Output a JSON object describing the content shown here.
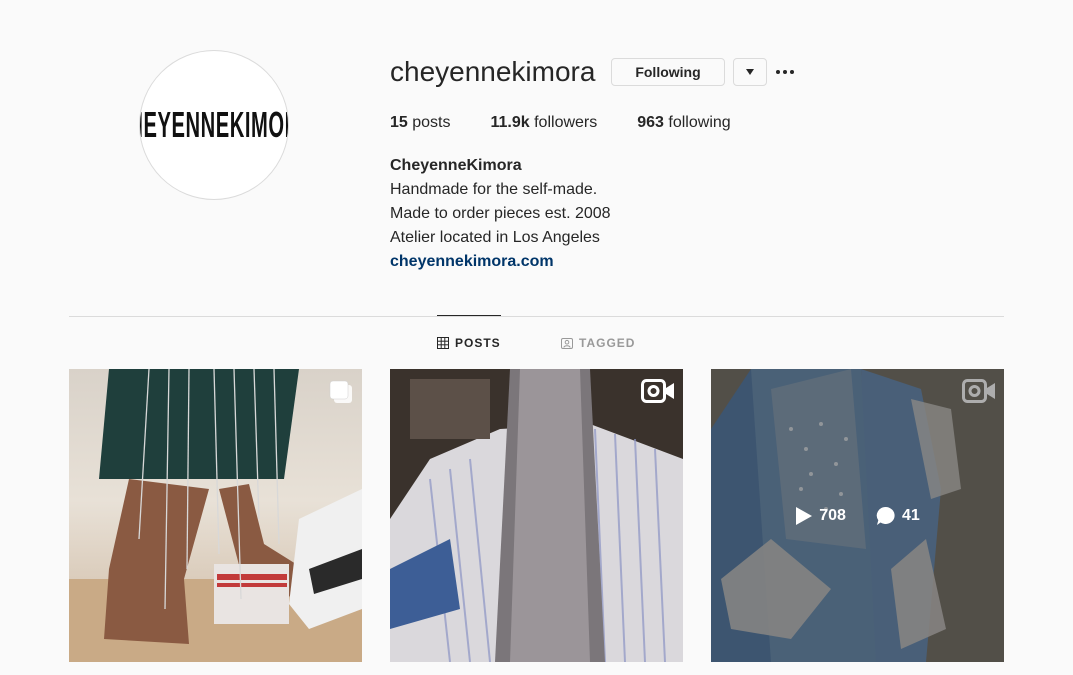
{
  "profile": {
    "avatar_text": "CHEYENNEKIMORA",
    "username": "cheyennekimora",
    "following_button": "Following"
  },
  "stats": {
    "posts_count": "15",
    "posts_label": "posts",
    "followers_count": "11.9k",
    "followers_label": "followers",
    "following_count": "963",
    "following_label": "following"
  },
  "bio": {
    "name": "CheyenneKimora",
    "line1": "Handmade for the self-made.",
    "line2": "Made to order pieces est. 2008",
    "line3": "Atelier located in Los Angeles",
    "link": "cheyennekimora.com"
  },
  "tabs": {
    "posts": "POSTS",
    "tagged": "TAGGED"
  },
  "posts": [
    {
      "type": "carousel"
    },
    {
      "type": "video"
    },
    {
      "type": "video",
      "hover": {
        "views": "708",
        "comments": "41"
      }
    }
  ],
  "colors": {
    "link": "#003569",
    "text": "#262626",
    "muted": "#999999",
    "border": "#dbdbdb",
    "background": "#fafafa"
  }
}
